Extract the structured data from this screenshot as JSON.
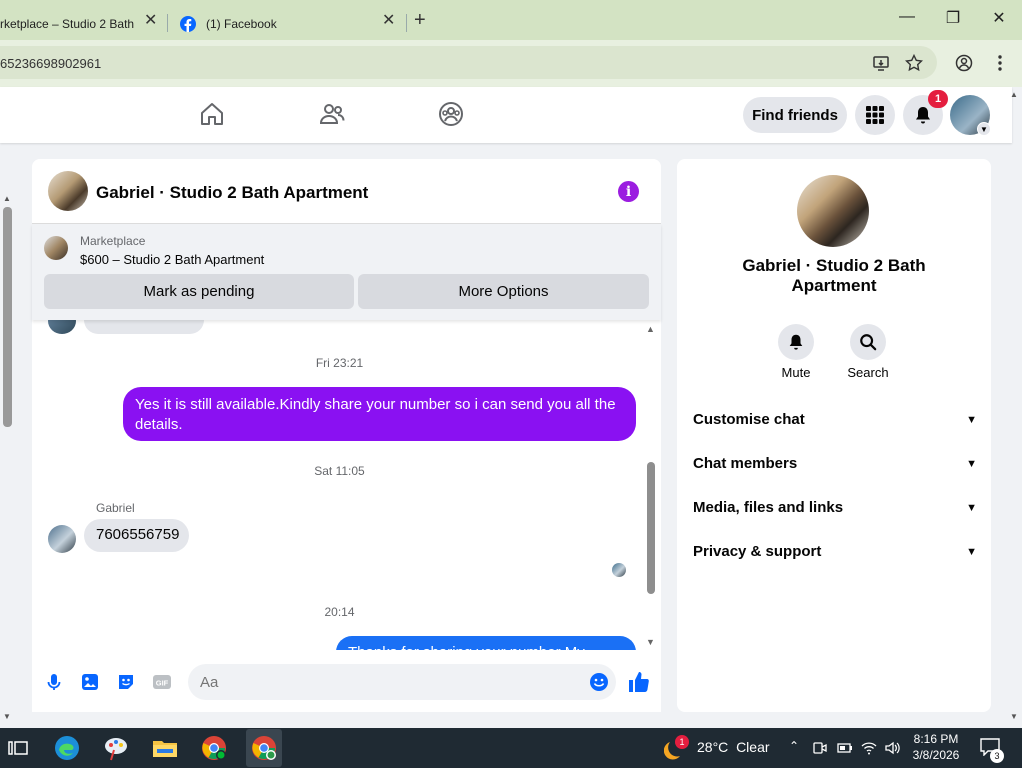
{
  "browser": {
    "tabs": [
      {
        "label": "rketplace – Studio 2 Bath"
      },
      {
        "label": "(1) Facebook"
      }
    ],
    "url": "65236698902961",
    "new_tab": "+",
    "close": "✕"
  },
  "header": {
    "find_friends": "Find friends",
    "notification_count": "1"
  },
  "chat": {
    "title": "Gabriel · Studio 2 Bath Apartment",
    "marketplace_label": "Marketplace",
    "listing": "$600 – Studio 2 Bath Apartment",
    "mark_pending": "Mark as pending",
    "more_options": "More Options",
    "messages": [
      {
        "timestamp": "Fri 23:21",
        "text": "Yes it is still available.Kindly share your number so i can send you all the details."
      },
      {
        "timestamp": "Sat 11:05",
        "sender": "Gabriel",
        "text": "7606556759"
      },
      {
        "timestamp": "20:14",
        "text": "Thanks for sharing your number My"
      }
    ],
    "input_placeholder": "Aa"
  },
  "profile": {
    "title": "Gabriel · Studio 2 Bath Apartment",
    "mute": "Mute",
    "search": "Search",
    "sections": [
      "Customise chat",
      "Chat members",
      "Media, files and links",
      "Privacy & support"
    ]
  },
  "taskbar": {
    "weather_badge": "1",
    "temperature": "28°C",
    "weather": "Clear",
    "time": "8:16 PM",
    "date": "3/8/2026",
    "notification_count": "3"
  },
  "colors": {
    "outgoing_bubble": "#8a11f2",
    "accent_blue": "#0866ff",
    "notification_red": "#e41e3f"
  }
}
